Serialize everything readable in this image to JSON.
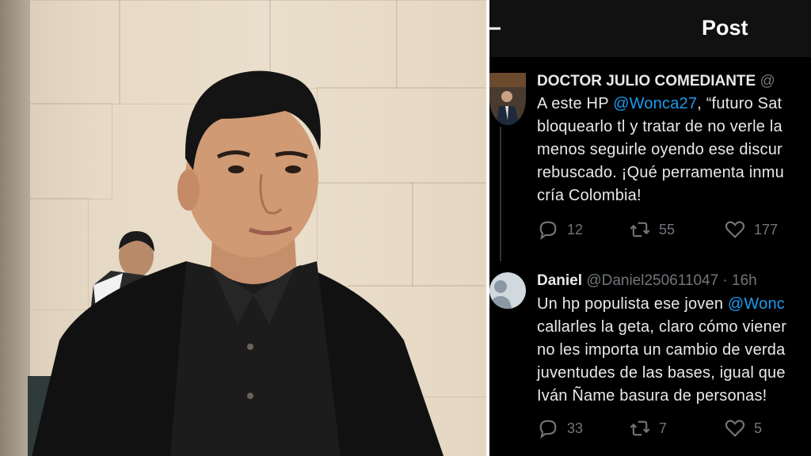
{
  "screen": {
    "header": {
      "title": "Post"
    },
    "tweets": [
      {
        "display_name": "DOCTOR JULIO COMEDIANTE",
        "handle": "@",
        "text_before": "A este HP ",
        "mention": "@Wonca27",
        "text_after": ", “futuro Sat\nbloquearlo tl y tratar de no verle la\nmenos seguirle oyendo ese discur\nrebuscado. ¡Qué perramenta inmu\ncría Colombia!",
        "replies": "12",
        "reposts": "55",
        "likes": "177"
      },
      {
        "display_name": "Daniel",
        "handle": "@Daniel250611047 · 16h",
        "text_before": "Un hp populista  ese joven ",
        "mention": "@Wonc",
        "text_after": "\ncallarles la geta, claro cómo viener\nno les importa un cambio de verda\njuventudes de las bases, igual que\nIván Ñame basura  de personas!",
        "replies": "33",
        "reposts": "7",
        "likes": "5"
      }
    ]
  },
  "colors": {
    "background": "#000000",
    "text": "#e7e9ea",
    "muted": "#71767b",
    "link": "#1d9bf0"
  },
  "icons": [
    "back-arrow-icon",
    "reply-icon",
    "repost-icon",
    "like-icon",
    "default-avatar-icon"
  ]
}
